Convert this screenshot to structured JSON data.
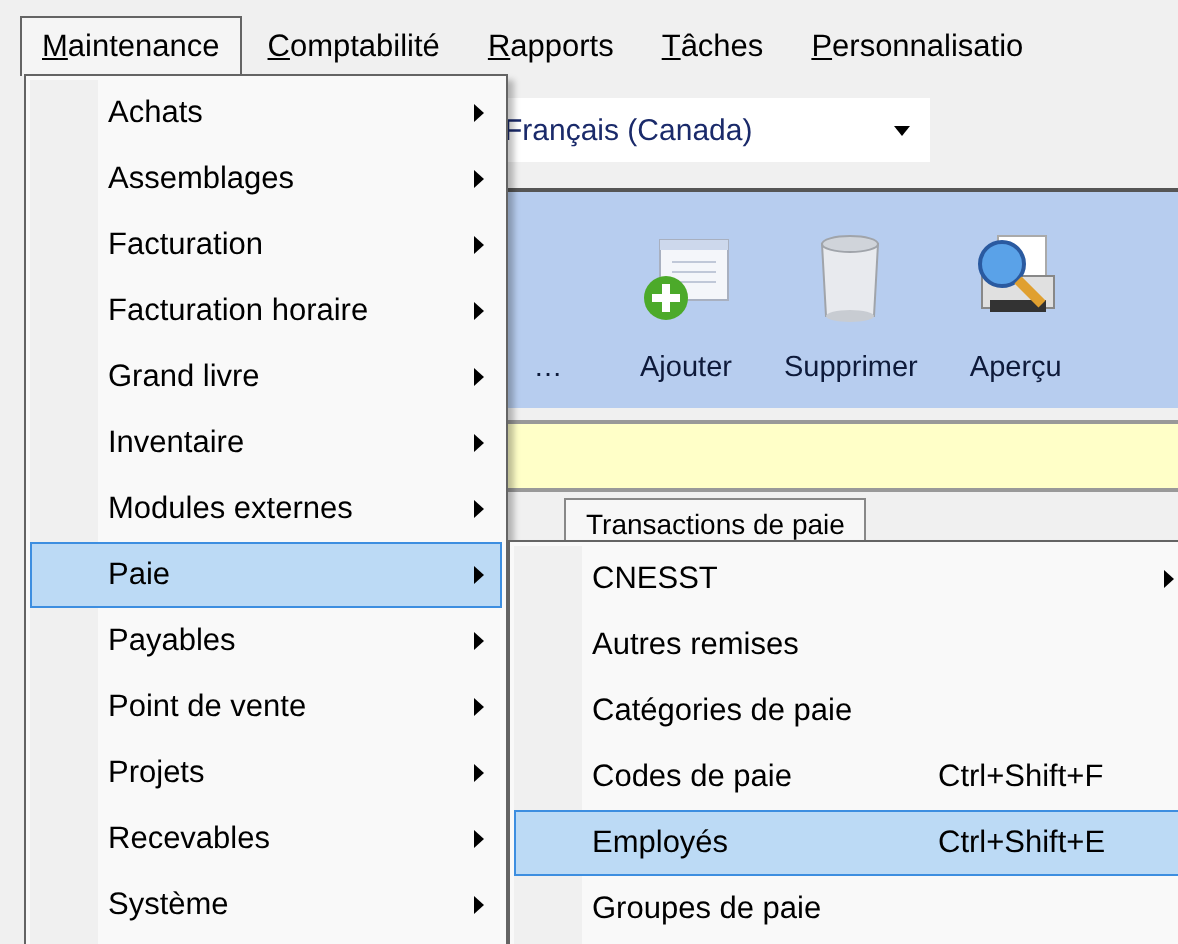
{
  "menu_bar": [
    {
      "key_letter": "M",
      "rest": "aintenance",
      "selected": true
    },
    {
      "key_letter": "C",
      "rest": "omptabilité",
      "selected": false
    },
    {
      "key_letter": "R",
      "rest": "apports",
      "selected": false
    },
    {
      "key_letter": "T",
      "rest": "âches",
      "selected": false
    },
    {
      "key_letter": "P",
      "rest": "ersonnalisatio",
      "selected": false
    }
  ],
  "language_select": {
    "value": "Français (Canada)"
  },
  "toolbar": [
    {
      "kind": "more",
      "label": "…"
    },
    {
      "kind": "add",
      "label": "Ajouter"
    },
    {
      "kind": "delete",
      "label": "Supprimer"
    },
    {
      "kind": "preview",
      "label": "Aperçu"
    }
  ],
  "tabs": [
    {
      "label": "Transactions de paie"
    }
  ],
  "maintenance_menu": [
    {
      "label": "Achats",
      "selected": false
    },
    {
      "label": "Assemblages",
      "selected": false
    },
    {
      "label": "Facturation",
      "selected": false
    },
    {
      "label": "Facturation horaire",
      "selected": false
    },
    {
      "label": "Grand livre",
      "selected": false
    },
    {
      "label": "Inventaire",
      "selected": false
    },
    {
      "label": "Modules externes",
      "selected": false
    },
    {
      "label": "Paie",
      "selected": true
    },
    {
      "label": "Payables",
      "selected": false
    },
    {
      "label": "Point de vente",
      "selected": false
    },
    {
      "label": "Projets",
      "selected": false
    },
    {
      "label": "Recevables",
      "selected": false
    },
    {
      "label": "Système",
      "selected": false
    }
  ],
  "paie_submenu": [
    {
      "label": "CNESST",
      "submenu": true,
      "selected": false
    },
    {
      "label": "Autres remises",
      "submenu": false,
      "selected": false
    },
    {
      "label": "Catégories de paie",
      "submenu": false,
      "selected": false
    },
    {
      "label": "Codes de paie",
      "shortcut": "Ctrl+Shift+F",
      "submenu": false,
      "selected": false
    },
    {
      "label": "Employés",
      "shortcut": "Ctrl+Shift+E",
      "submenu": false,
      "selected": true
    },
    {
      "label": "Groupes de paie",
      "submenu": false,
      "selected": false
    }
  ]
}
